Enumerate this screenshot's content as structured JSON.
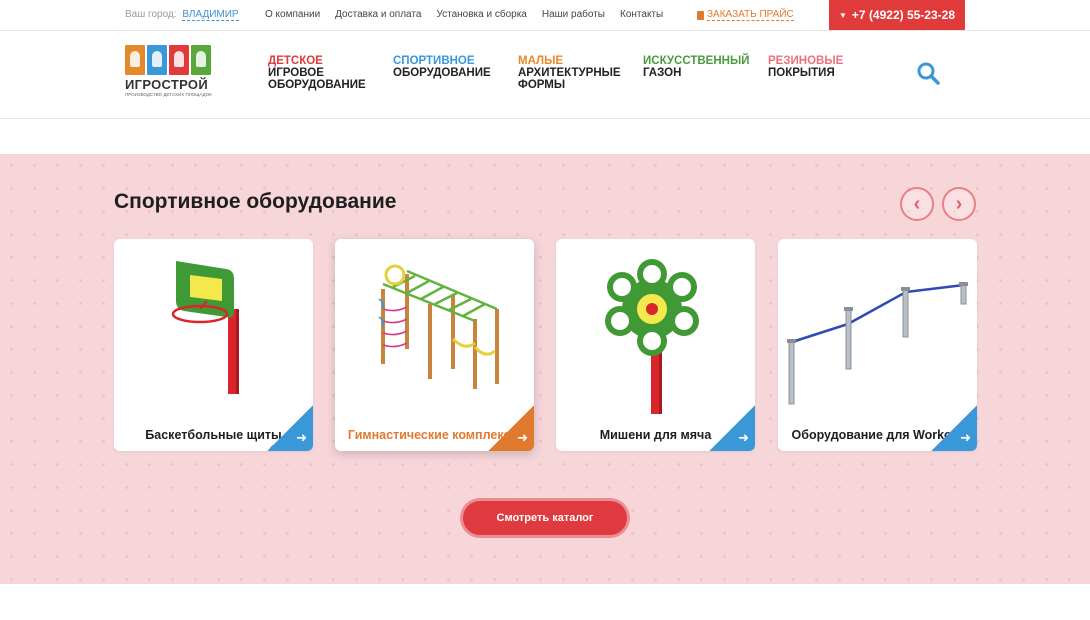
{
  "topbar": {
    "city_label": "Ваш город:",
    "city_value": "ВЛАДИМИР",
    "links": [
      "О компании",
      "Доставка и оплата",
      "Установка и сборка",
      "Наши работы",
      "Контакты"
    ],
    "price_label": "ЗАКАЗАТЬ ПРАЙС",
    "phone": "+7 (4922) 55-23-28"
  },
  "logo": {
    "name": "ИГРОСТРОЙ",
    "tagline": "ПРОИЗВОДСТВО ДЕТСКИХ ПЛОЩАДОК",
    "tile_colors": [
      "#e58a2c",
      "#3a97d8",
      "#e03a3a",
      "#5aa83c"
    ]
  },
  "nav": [
    {
      "accent": "ДЕТСКОЕ",
      "rest": "ИГРОВОЕ ОБОРУДОВАНИЕ",
      "color": "#e03a3a"
    },
    {
      "accent": "СПОРТИВНОЕ",
      "rest": "ОБОРУДОВАНИЕ",
      "color": "#3a97d8"
    },
    {
      "accent": "МАЛЫЕ",
      "rest": "АРХИТЕКТУРНЫЕ ФОРМЫ",
      "color": "#e58a2c"
    },
    {
      "accent": "ИСКУССТВЕННЫЙ",
      "rest": "ГАЗОН",
      "color": "#4a9b3c"
    },
    {
      "accent": "РЕЗИНОВЫЕ",
      "rest": "ПОКРЫТИЯ",
      "color": "#e9717b"
    }
  ],
  "section": {
    "title": "Спортивное оборудование",
    "cards": [
      {
        "label": "Баскетбольные щиты",
        "icon": "basketball-hoop-illustration"
      },
      {
        "label": "Гимнастические комплексы",
        "icon": "gym-complex-illustration"
      },
      {
        "label": "Мишени для мяча",
        "icon": "ball-target-illustration"
      },
      {
        "label": "Оборудование для Workout",
        "icon": "workout-bars-illustration"
      }
    ],
    "cta_label": "Смотреть каталог"
  },
  "colors": {
    "accent_red": "#e03a3a",
    "accent_blue": "#3a97d8",
    "accent_orange": "#e07a2e",
    "section_bg": "#f7d6da"
  }
}
